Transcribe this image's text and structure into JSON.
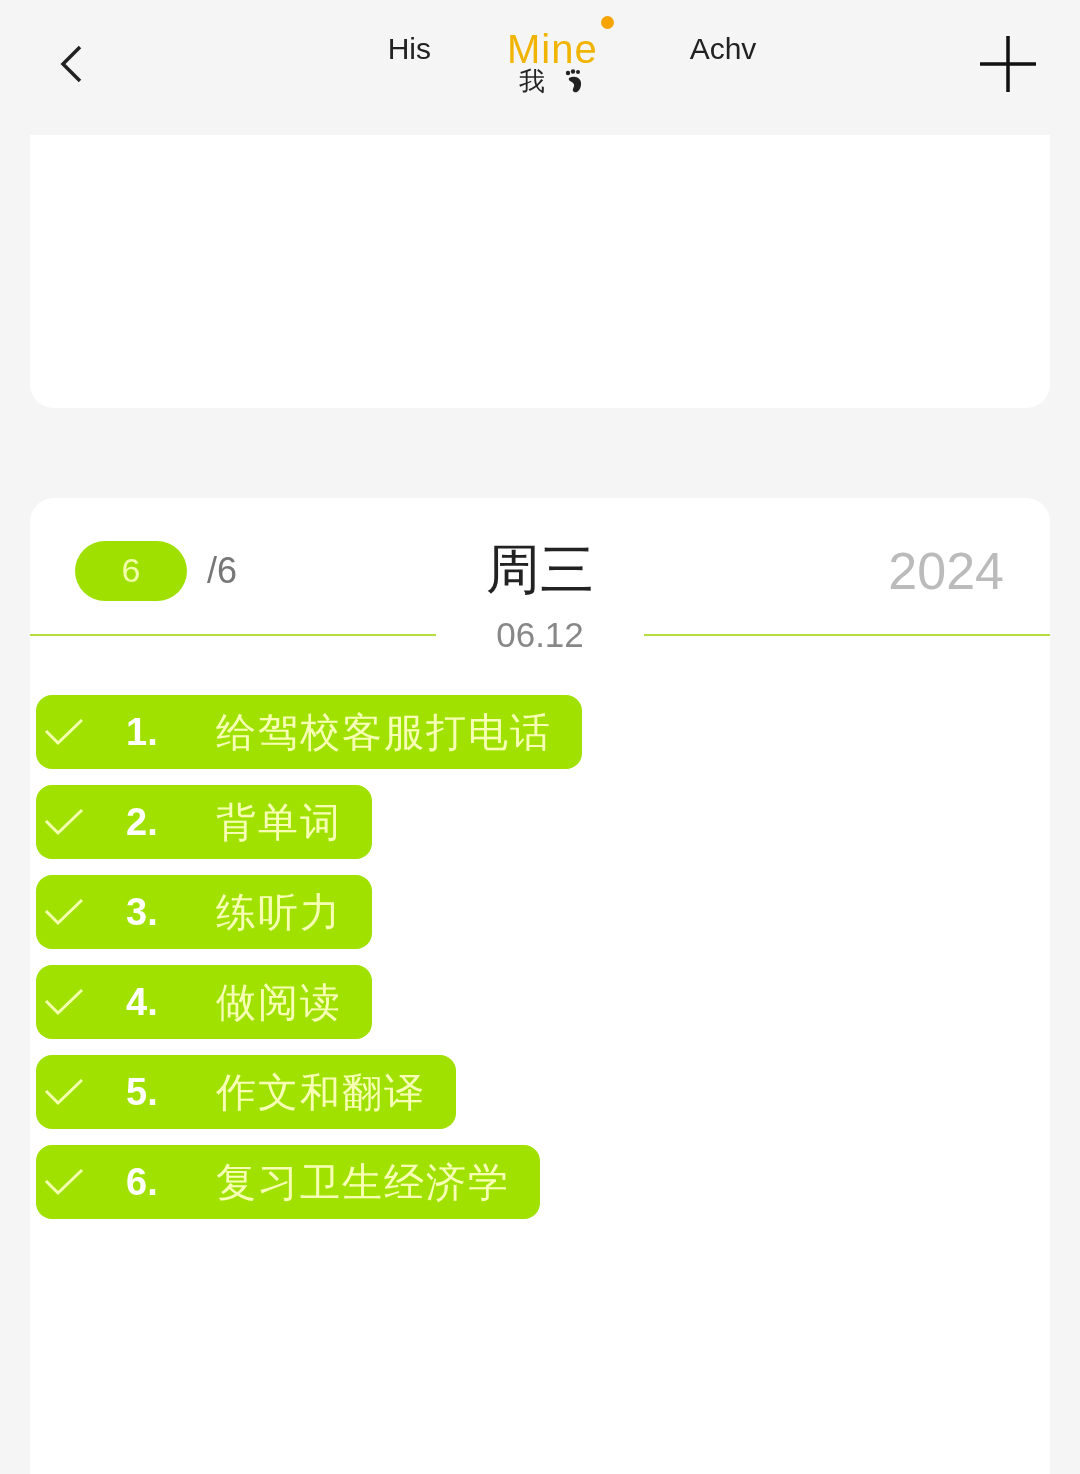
{
  "tabs": [
    {
      "label": "His",
      "selected": false,
      "dot": false
    },
    {
      "label": "Mine",
      "subtitle": "我",
      "selected": true,
      "dot": true
    },
    {
      "label": "Achv",
      "selected": false,
      "dot": false
    }
  ],
  "day_card": {
    "done_count": "6",
    "total": "/6",
    "weekday": "周三",
    "year": "2024",
    "date": "06.12",
    "tasks": [
      {
        "number": "1.",
        "text": "给驾校客服打电话",
        "checked": true
      },
      {
        "number": "2.",
        "text": "背单词",
        "checked": true
      },
      {
        "number": "3.",
        "text": "练听力",
        "checked": true
      },
      {
        "number": "4.",
        "text": "做阅读",
        "checked": true
      },
      {
        "number": "5.",
        "text": "作文和翻译",
        "checked": true
      },
      {
        "number": "6.",
        "text": "复习卫生经济学",
        "checked": true
      }
    ]
  }
}
